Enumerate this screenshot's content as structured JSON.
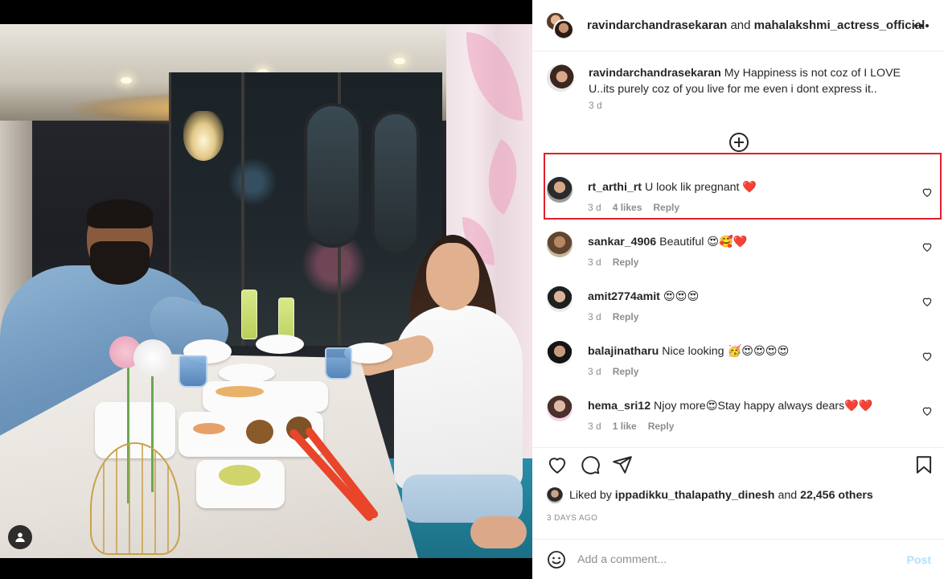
{
  "post": {
    "header": {
      "author": "ravindarchandrasekaran",
      "connector": "and",
      "collaborator": "mahalakshmi_actress_official",
      "more_icon": "more-horizontal-icon"
    },
    "caption": {
      "username": "ravindarchandrasekaran",
      "text": "My Happiness is not coz of I LOVE U..its purely coz of you live for me even i dont express it..",
      "time": "3 d"
    },
    "load_more_icon": "plus-circle-icon",
    "comments": [
      {
        "username": "rt_arthi_rt",
        "text": "U look lik pregnant ❤️",
        "time": "3 d",
        "likes": "4 likes",
        "reply": "Reply",
        "highlighted": true
      },
      {
        "username": "sankar_4906",
        "text": "Beautiful 😍🥰❤️",
        "time": "3 d",
        "likes": "",
        "reply": "Reply",
        "highlighted": false
      },
      {
        "username": "amit2774amit",
        "text": "😍😍😍",
        "time": "3 d",
        "likes": "",
        "reply": "Reply",
        "highlighted": false
      },
      {
        "username": "balajinatharu",
        "text": "Nice looking 🥳😍😍😍😍",
        "time": "3 d",
        "likes": "",
        "reply": "Reply",
        "highlighted": false
      },
      {
        "username": "hema_sri12",
        "text": "Njoy more😍Stay happy always dears❤️❤️",
        "time": "3 d",
        "likes": "1 like",
        "reply": "Reply",
        "highlighted": false
      }
    ],
    "actions": {
      "like_icon": "heart-icon",
      "comment_icon": "comment-icon",
      "share_icon": "send-icon",
      "save_icon": "bookmark-icon"
    },
    "likes": {
      "prefix": "Liked by",
      "user": "ippadikku_thalapathy_dinesh",
      "connector": "and",
      "others": "22,456 others"
    },
    "posted_ago": "3 DAYS AGO",
    "comment_input": {
      "placeholder": "Add a comment...",
      "post_label": "Post",
      "emoji_icon": "emoji-icon"
    }
  },
  "colors": {
    "highlight_box": "#e0202a",
    "post_button_disabled": "#b2dffc",
    "secondary_text": "#8e8e8e"
  }
}
